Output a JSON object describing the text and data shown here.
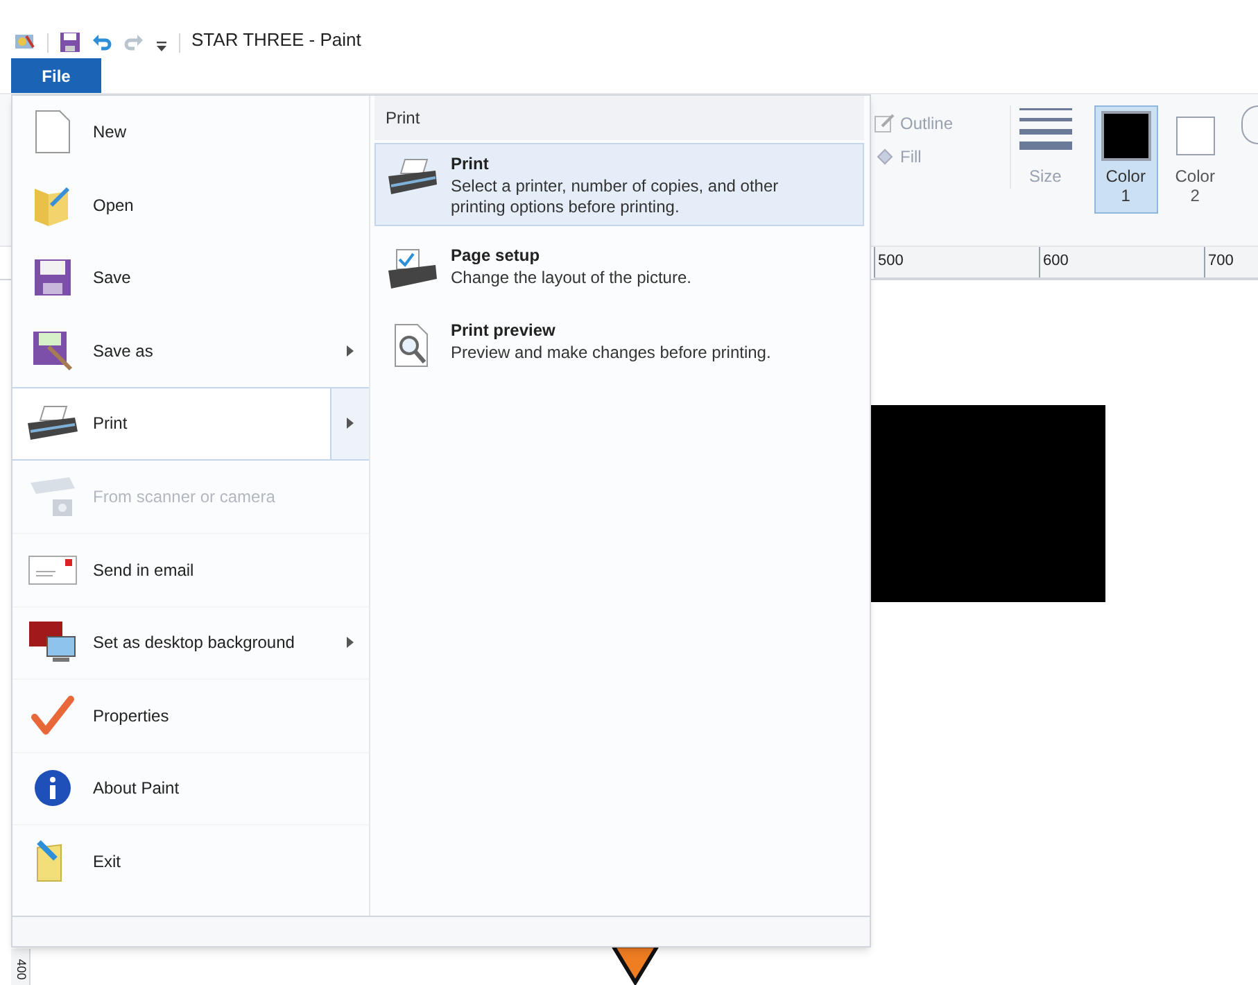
{
  "title_bar": {
    "title": "STAR THREE - Paint"
  },
  "file_tab": {
    "label": "File",
    "selected": true
  },
  "ribbon": {
    "outline": "Outline",
    "fill": "Fill",
    "size": "Size",
    "colors": [
      {
        "label": "Color 1",
        "color": "#000000",
        "selected": true
      },
      {
        "label": "Color 2",
        "color": "#ffffff",
        "selected": false
      }
    ]
  },
  "ruler": {
    "marks": [
      "500",
      "600",
      "700"
    ],
    "vertical_mark": "400"
  },
  "file_menu": {
    "items": [
      {
        "label": "New",
        "submenu": false,
        "selected": false,
        "disabled": false
      },
      {
        "label": "Open",
        "submenu": false,
        "selected": false,
        "disabled": false
      },
      {
        "label": "Save",
        "submenu": false,
        "selected": false,
        "disabled": false
      },
      {
        "label": "Save as",
        "submenu": true,
        "selected": false,
        "disabled": false
      },
      {
        "label": "Print",
        "submenu": true,
        "selected": true,
        "disabled": false
      },
      {
        "label": "From scanner or camera",
        "submenu": false,
        "selected": false,
        "disabled": true
      },
      {
        "label": "Send in email",
        "submenu": false,
        "selected": false,
        "disabled": false
      },
      {
        "label": "Set as desktop background",
        "submenu": true,
        "selected": false,
        "disabled": false
      },
      {
        "label": "Properties",
        "submenu": false,
        "selected": false,
        "disabled": false
      },
      {
        "label": "About Paint",
        "submenu": false,
        "selected": false,
        "disabled": false
      },
      {
        "label": "Exit",
        "submenu": false,
        "selected": false,
        "disabled": false
      }
    ],
    "submenu": {
      "heading": "Print",
      "items": [
        {
          "title": "Print",
          "description": "Select a printer, number of copies, and other printing options before printing.",
          "selected": true
        },
        {
          "title": "Page setup",
          "description": "Change the layout of the picture.",
          "selected": false
        },
        {
          "title": "Print preview",
          "description": "Preview and make changes before printing.",
          "selected": false
        }
      ]
    }
  }
}
